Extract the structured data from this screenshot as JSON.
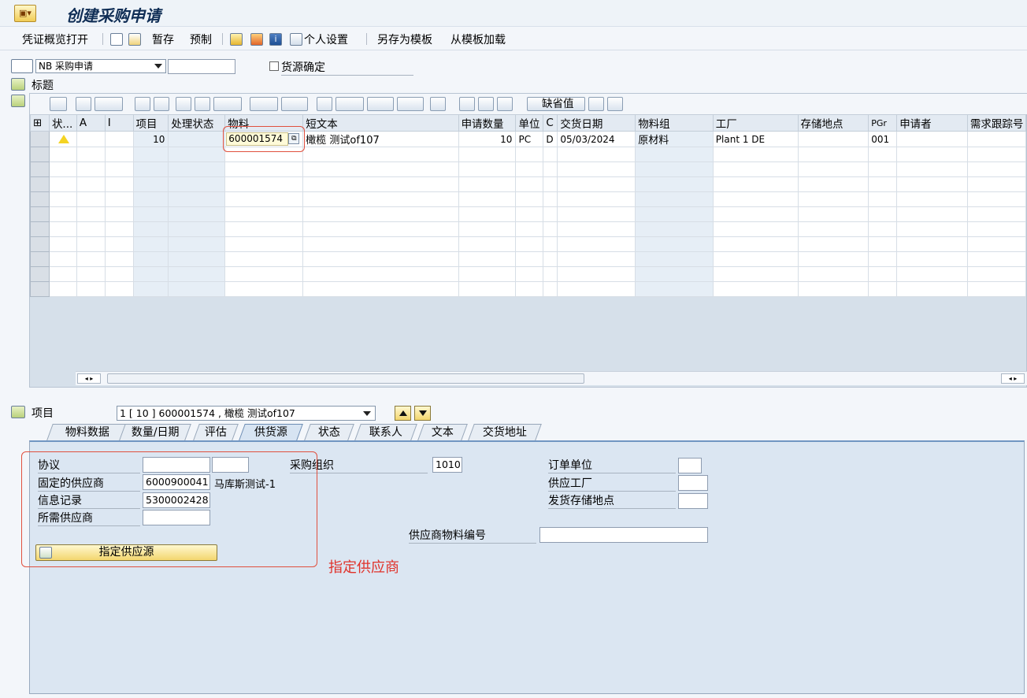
{
  "window": {
    "title": "创建采购申请"
  },
  "toolbar": {
    "items": [
      "凭证概览打开",
      "暂存",
      "预制",
      "个人设置",
      "另存为模板",
      "从模板加载"
    ]
  },
  "header": {
    "doc_type": "NB 采购申请",
    "doc_type_extra": "",
    "source_confirm_label": "货源确定",
    "header_label": "标题"
  },
  "grid": {
    "default_values_label": "缺省值",
    "columns": [
      "状...",
      "A",
      "I",
      "项目",
      "处理状态",
      "物料",
      "短文本",
      "申请数量",
      "单位",
      "C",
      "交货日期",
      "物料组",
      "工厂",
      "存储地点",
      "PGr",
      "申请者",
      "需求跟踪号"
    ],
    "rows": [
      {
        "status_icon": "warning-icon",
        "item": "10",
        "material": "600001574",
        "short_text": "橄榄 测试of107",
        "qty": "10",
        "unit": "PC",
        "c": "D",
        "date": "05/03/2024",
        "mat_group": "原材料",
        "plant": "Plant 1 DE",
        "storage": "",
        "pgr": "001",
        "requester": "",
        "tracking": ""
      }
    ],
    "empty_rows": 10
  },
  "item_section": {
    "label": "项目",
    "selector": "1 [ 10 ] 600001574 , 橄榄 测试of107"
  },
  "tabs": [
    "物料数据",
    "数量/日期",
    "评估",
    "供货源",
    "状态",
    "联系人",
    "文本",
    "交货地址"
  ],
  "active_tab": "供货源",
  "source_tab": {
    "agreement_label": "协议",
    "agreement_value": "",
    "agreement_item": "",
    "fixed_vendor_label": "固定的供应商",
    "fixed_vendor_value": "6000900041",
    "fixed_vendor_name": "马库斯测试-1",
    "info_record_label": "信息记录",
    "info_record_value": "5300002428",
    "desired_vendor_label": "所需供应商",
    "desired_vendor_value": "",
    "purch_org_label": "采购组织",
    "purch_org_value": "1010",
    "order_unit_label": "订单单位",
    "supply_plant_label": "供应工厂",
    "issue_storage_label": "发货存储地点",
    "vendor_material_label": "供应商物料编号",
    "assign_button": "指定供应源"
  },
  "annotation": {
    "text": "指定供应商",
    "color": "#e0322a"
  }
}
